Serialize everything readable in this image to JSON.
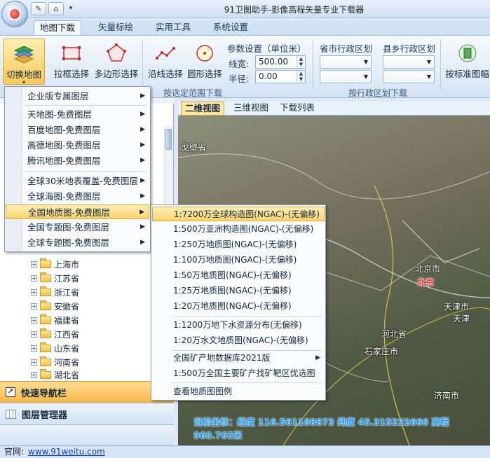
{
  "window": {
    "title": "91卫图助手-影像高程矢量专业下载器"
  },
  "ribbon_tabs": [
    "地图下载",
    "矢量标绘",
    "实用工具",
    "系统设置"
  ],
  "ribbon": {
    "switch_map": "切换地图",
    "rect_select": "拉框选择",
    "polygon_select": "多边形选择",
    "line_select": "沿线选择",
    "circle_select": "圆形选择",
    "group_select_range": "按选定范围下载",
    "params_title": "参数设置（单位米）",
    "line_width_label": "线宽:",
    "line_width_value": "500.00",
    "radius_label": "半径:",
    "radius_value": "0.00",
    "province_city_label": "省市行政区划",
    "county_label": "县乡行政区划",
    "group_admin": "按行政区划下载",
    "standard_map": "按标准图幅"
  },
  "map_menu": {
    "items": [
      "企业版专属图层",
      "天地图-免费图层",
      "百度地图-免费图层",
      "高德地图-免费图层",
      "腾讯地图-免费图层",
      "全球30米地表覆盖-免费图层",
      "全球海图-免费图层",
      "全国地质图-免费图层",
      "全国专题图-免费图层",
      "全球专题图-免费图层"
    ]
  },
  "geology_submenu": {
    "items": [
      "1:7200万全球构造图(NGAC)-(无偏移)",
      "1:500万亚洲构造图(NGAC)-(无偏移)",
      "1:250万地质图(NGAC)-(无偏移)",
      "1:100万地质图(NGAC)-(无偏移)",
      "1:50万地质图(NGAC)-(无偏移)",
      "1:25万地质图(NGAC)-(无偏移)",
      "1:20万地质图(NGAC)-(无偏移)",
      "1:1200万地下水资源分布(无偏移)",
      "1:20万水文地质图(NGAC)-(无偏移)",
      "全国矿产地数据库2021版",
      "1:500万全国主要矿产找矿靶区优选图",
      "查看地质图图例"
    ]
  },
  "tree": {
    "items": [
      "上海市",
      "江苏省",
      "浙江省",
      "安徽省",
      "福建省",
      "江西省",
      "山东省",
      "河南省",
      "湖北省"
    ]
  },
  "nav": {
    "quick": "快速导航栏",
    "layers": "图层管理器"
  },
  "view_tabs": [
    "二维视图",
    "三维视图",
    "下载列表"
  ],
  "map": {
    "labels": {
      "gobi": "戈壁省",
      "beijing_city": "北京市",
      "beijing": "北京",
      "tianjin_city": "天津市",
      "tianjin": "天津",
      "hebei": "河北省",
      "shijiazhuang": "石家庄市",
      "jinan": "济南市"
    },
    "coords": "当前坐标：经度 116.561188873 纬度 45.315222666 高程 968.765米"
  },
  "status": {
    "label": "官网:",
    "link": "www.91weitu.com"
  }
}
